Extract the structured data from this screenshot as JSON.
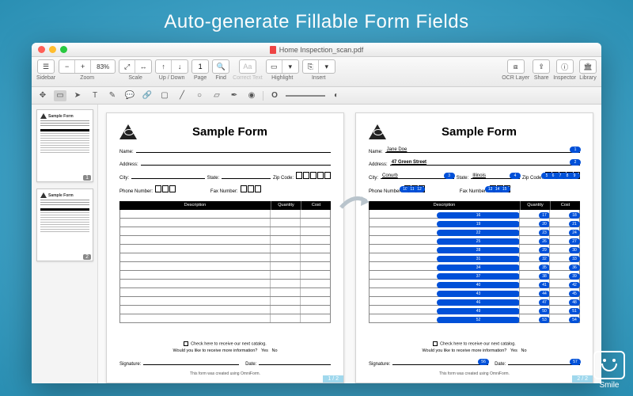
{
  "hero": {
    "title": "Auto-generate Fillable Form Fields"
  },
  "window": {
    "title": "Home Inspection_scan.pdf"
  },
  "toolbar": {
    "sidebar": "Sidebar",
    "zoom": {
      "label": "Zoom",
      "value": "83%"
    },
    "scale": "Scale",
    "updown": "Up / Down",
    "page": {
      "label": "Page",
      "value": "1"
    },
    "find": "Find",
    "correct": "Correct Text",
    "highlight": "Highlight",
    "insert": "Insert",
    "ocr": "OCR Layer",
    "share": "Share",
    "inspector": "Inspector",
    "library": "Library"
  },
  "thumbnails": {
    "p1": "1",
    "p2": "2",
    "mini_title": "Sample Form"
  },
  "form": {
    "title": "Sample Form",
    "labels": {
      "name": "Name:",
      "address": "Address:",
      "city": "City:",
      "state": "State:",
      "zip": "Zip Code:",
      "phone": "Phone Number:",
      "fax": "Fax Number:",
      "desc": "Description",
      "qty": "Quantity",
      "cost": "Cost",
      "cat": "Check here to receive our next catalog.",
      "more": "Would you like to receive more information?",
      "yes": "Yes",
      "no": "No",
      "sig": "Signature:",
      "date": "Date:",
      "footer": "This form was created using OmniForm."
    },
    "filled": {
      "name": "Jane Doe",
      "address": "47 Green Street",
      "city": "Conurb",
      "state": "Illinois"
    }
  },
  "pageind": {
    "left": "1 / 2",
    "right": "2 / 2"
  },
  "brand": "Smile"
}
